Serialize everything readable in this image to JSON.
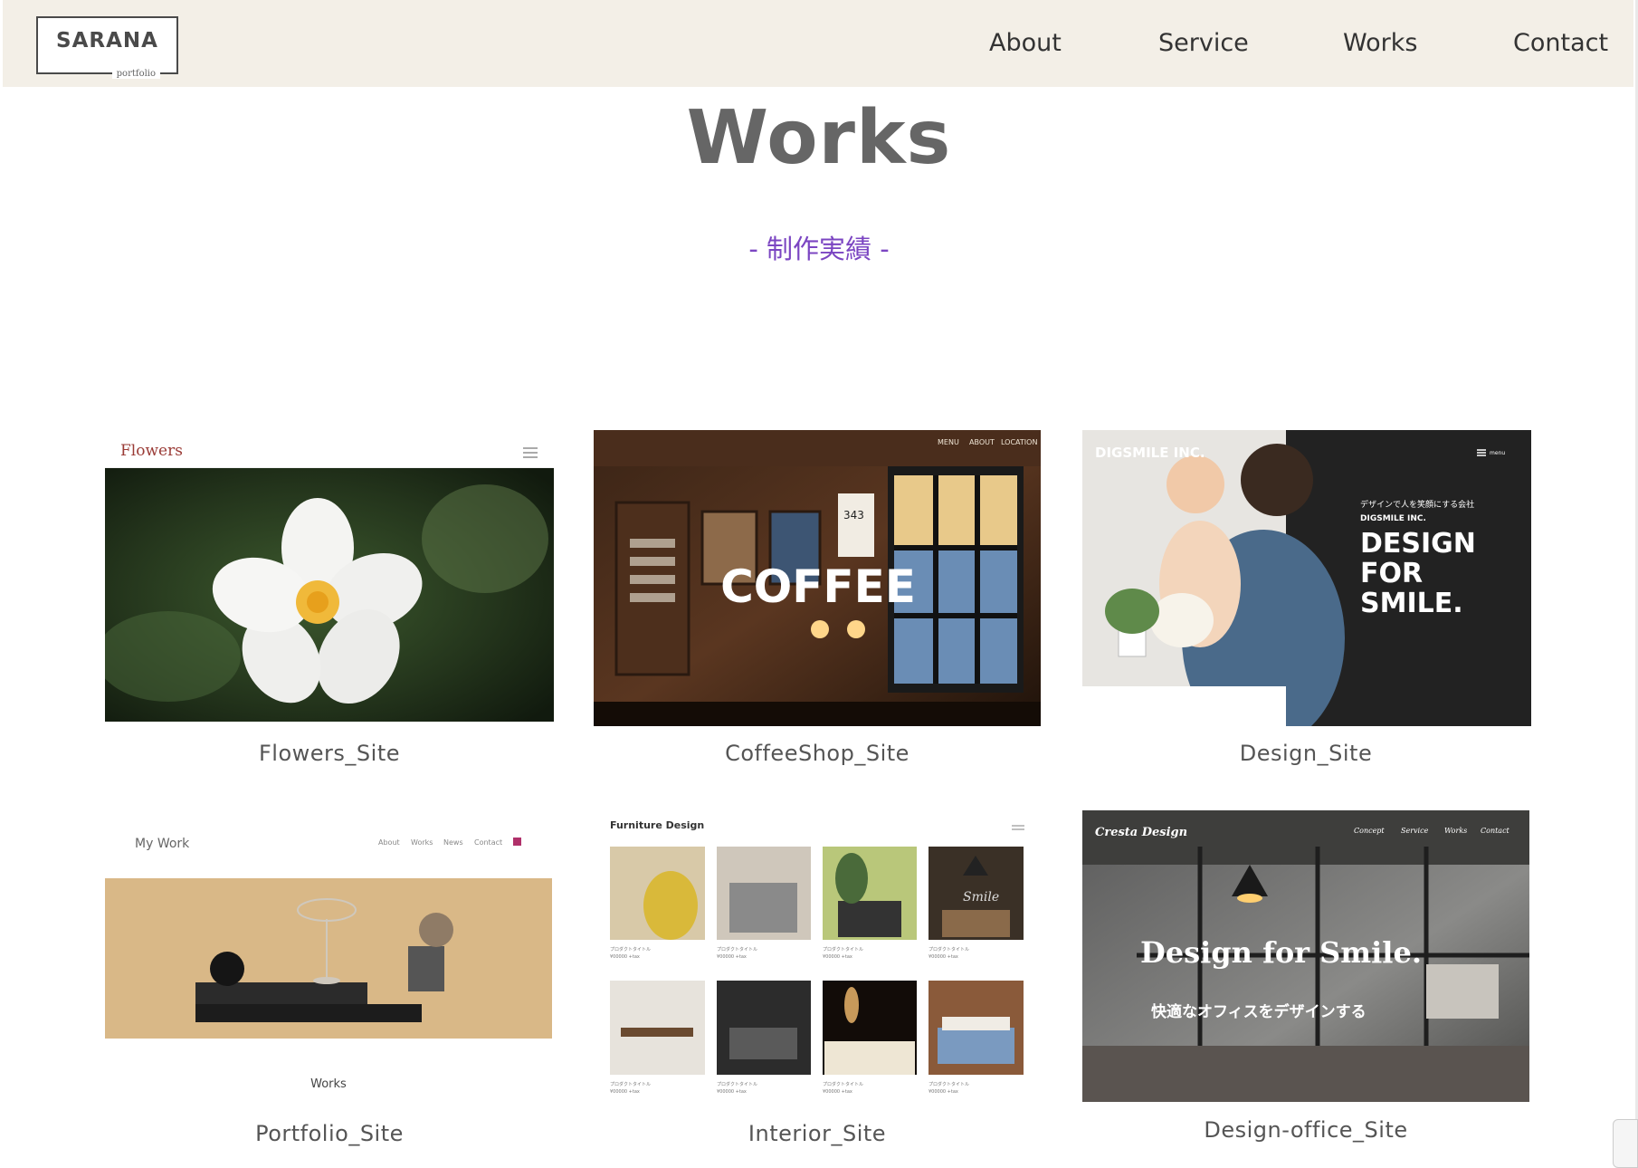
{
  "header": {
    "logo_text": "SARANA",
    "logo_subtext": "portfolio",
    "nav": [
      {
        "label": "About"
      },
      {
        "label": "Service"
      },
      {
        "label": "Works"
      },
      {
        "label": "Contact"
      }
    ]
  },
  "section": {
    "title": "Works",
    "subtitle": "- 制作実績 -"
  },
  "works": [
    {
      "caption": "Flowers_Site",
      "thumb_texts": {
        "brand": "Flowers"
      }
    },
    {
      "caption": "CoffeeShop_Site",
      "thumb_texts": {
        "headline": "COFFEE",
        "nav": [
          "MENU",
          "ABOUT",
          "LOCATION"
        ],
        "sign": "343"
      }
    },
    {
      "caption": "Design_Site",
      "thumb_texts": {
        "brand": "DIGSMILE INC.",
        "menu": "menu",
        "tagline_jp": "デザインで人を笑顔にする会社",
        "tagline_en": "DIGSMILE INC.",
        "headline": [
          "DESIGN",
          "FOR",
          "SMILE."
        ]
      }
    },
    {
      "caption": "Portfolio_Site",
      "thumb_texts": {
        "brand": "My Work",
        "nav": [
          "About",
          "Works",
          "News",
          "Contact"
        ],
        "footer": "Works"
      }
    },
    {
      "caption": "Interior_Site",
      "thumb_texts": {
        "brand": "Furniture Design",
        "item_title": "プロダクトタイトル",
        "item_price": "¥00000 +tax",
        "sign": "Smile"
      }
    },
    {
      "caption": "Design-office_Site",
      "thumb_texts": {
        "brand": "Cresta Design",
        "nav": [
          "Concept",
          "Service",
          "Works",
          "Contact"
        ],
        "headline": "Design for Smile.",
        "subline": "快適なオフィスをデザインする"
      }
    }
  ],
  "colors": {
    "header_bg": "#f3efe7",
    "title": "#666666",
    "subtitle": "#7b45c2",
    "caption": "#555555"
  }
}
